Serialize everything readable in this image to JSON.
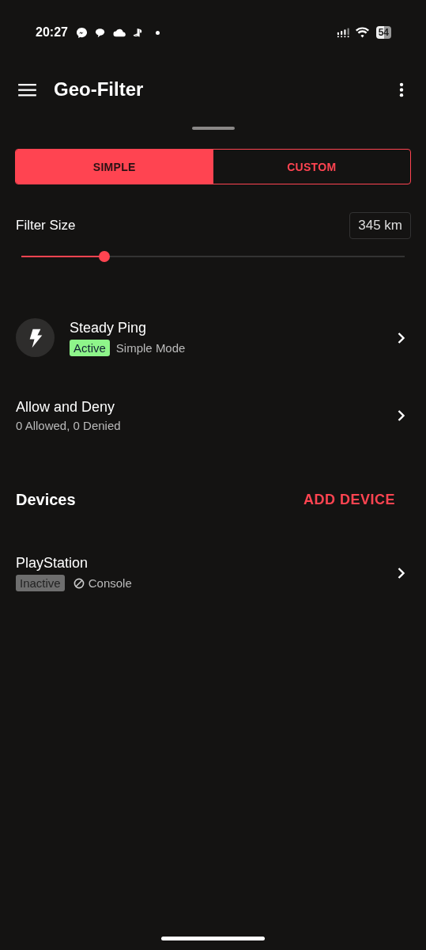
{
  "status_bar": {
    "time": "20:27",
    "battery": "54"
  },
  "app_bar": {
    "title": "Geo-Filter"
  },
  "mode_tabs": [
    {
      "label": "SIMPLE",
      "selected": true
    },
    {
      "label": "CUSTOM",
      "selected": false
    }
  ],
  "filter_size": {
    "label": "Filter Size",
    "reading": "345 km",
    "level": 0.216
  },
  "steady_ping": {
    "title": "Steady Ping",
    "status": "Active",
    "active": true,
    "mode": "Simple Mode"
  },
  "allow_deny": {
    "title": "Allow and Deny",
    "summary": "0 Allowed, 0 Denied"
  },
  "devices": {
    "heading": "Devices",
    "add_button": "ADD DEVICE",
    "items": [
      {
        "name": "PlayStation",
        "status": "Inactive",
        "active": false,
        "type": "Console"
      }
    ]
  }
}
